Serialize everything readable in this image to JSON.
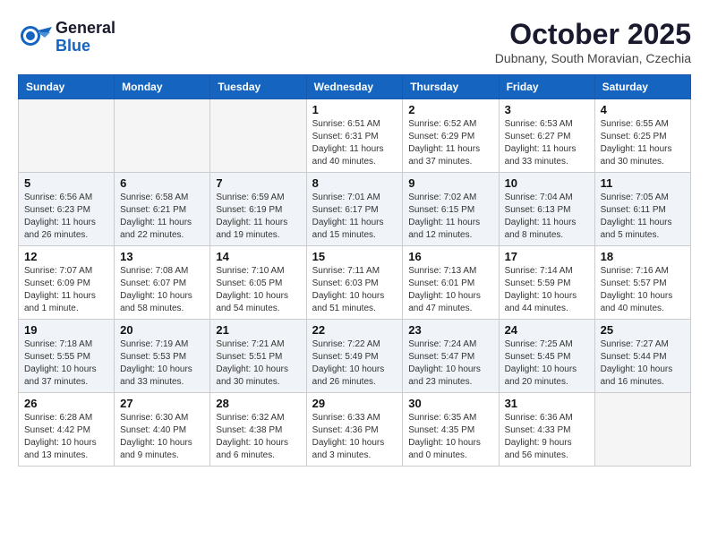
{
  "header": {
    "logo_line1": "General",
    "logo_line2": "Blue",
    "month_title": "October 2025",
    "subtitle": "Dubnany, South Moravian, Czechia"
  },
  "weekdays": [
    "Sunday",
    "Monday",
    "Tuesday",
    "Wednesday",
    "Thursday",
    "Friday",
    "Saturday"
  ],
  "weeks": [
    [
      {
        "day": "",
        "info": ""
      },
      {
        "day": "",
        "info": ""
      },
      {
        "day": "",
        "info": ""
      },
      {
        "day": "1",
        "info": "Sunrise: 6:51 AM\nSunset: 6:31 PM\nDaylight: 11 hours\nand 40 minutes."
      },
      {
        "day": "2",
        "info": "Sunrise: 6:52 AM\nSunset: 6:29 PM\nDaylight: 11 hours\nand 37 minutes."
      },
      {
        "day": "3",
        "info": "Sunrise: 6:53 AM\nSunset: 6:27 PM\nDaylight: 11 hours\nand 33 minutes."
      },
      {
        "day": "4",
        "info": "Sunrise: 6:55 AM\nSunset: 6:25 PM\nDaylight: 11 hours\nand 30 minutes."
      }
    ],
    [
      {
        "day": "5",
        "info": "Sunrise: 6:56 AM\nSunset: 6:23 PM\nDaylight: 11 hours\nand 26 minutes."
      },
      {
        "day": "6",
        "info": "Sunrise: 6:58 AM\nSunset: 6:21 PM\nDaylight: 11 hours\nand 22 minutes."
      },
      {
        "day": "7",
        "info": "Sunrise: 6:59 AM\nSunset: 6:19 PM\nDaylight: 11 hours\nand 19 minutes."
      },
      {
        "day": "8",
        "info": "Sunrise: 7:01 AM\nSunset: 6:17 PM\nDaylight: 11 hours\nand 15 minutes."
      },
      {
        "day": "9",
        "info": "Sunrise: 7:02 AM\nSunset: 6:15 PM\nDaylight: 11 hours\nand 12 minutes."
      },
      {
        "day": "10",
        "info": "Sunrise: 7:04 AM\nSunset: 6:13 PM\nDaylight: 11 hours\nand 8 minutes."
      },
      {
        "day": "11",
        "info": "Sunrise: 7:05 AM\nSunset: 6:11 PM\nDaylight: 11 hours\nand 5 minutes."
      }
    ],
    [
      {
        "day": "12",
        "info": "Sunrise: 7:07 AM\nSunset: 6:09 PM\nDaylight: 11 hours\nand 1 minute."
      },
      {
        "day": "13",
        "info": "Sunrise: 7:08 AM\nSunset: 6:07 PM\nDaylight: 10 hours\nand 58 minutes."
      },
      {
        "day": "14",
        "info": "Sunrise: 7:10 AM\nSunset: 6:05 PM\nDaylight: 10 hours\nand 54 minutes."
      },
      {
        "day": "15",
        "info": "Sunrise: 7:11 AM\nSunset: 6:03 PM\nDaylight: 10 hours\nand 51 minutes."
      },
      {
        "day": "16",
        "info": "Sunrise: 7:13 AM\nSunset: 6:01 PM\nDaylight: 10 hours\nand 47 minutes."
      },
      {
        "day": "17",
        "info": "Sunrise: 7:14 AM\nSunset: 5:59 PM\nDaylight: 10 hours\nand 44 minutes."
      },
      {
        "day": "18",
        "info": "Sunrise: 7:16 AM\nSunset: 5:57 PM\nDaylight: 10 hours\nand 40 minutes."
      }
    ],
    [
      {
        "day": "19",
        "info": "Sunrise: 7:18 AM\nSunset: 5:55 PM\nDaylight: 10 hours\nand 37 minutes."
      },
      {
        "day": "20",
        "info": "Sunrise: 7:19 AM\nSunset: 5:53 PM\nDaylight: 10 hours\nand 33 minutes."
      },
      {
        "day": "21",
        "info": "Sunrise: 7:21 AM\nSunset: 5:51 PM\nDaylight: 10 hours\nand 30 minutes."
      },
      {
        "day": "22",
        "info": "Sunrise: 7:22 AM\nSunset: 5:49 PM\nDaylight: 10 hours\nand 26 minutes."
      },
      {
        "day": "23",
        "info": "Sunrise: 7:24 AM\nSunset: 5:47 PM\nDaylight: 10 hours\nand 23 minutes."
      },
      {
        "day": "24",
        "info": "Sunrise: 7:25 AM\nSunset: 5:45 PM\nDaylight: 10 hours\nand 20 minutes."
      },
      {
        "day": "25",
        "info": "Sunrise: 7:27 AM\nSunset: 5:44 PM\nDaylight: 10 hours\nand 16 minutes."
      }
    ],
    [
      {
        "day": "26",
        "info": "Sunrise: 6:28 AM\nSunset: 4:42 PM\nDaylight: 10 hours\nand 13 minutes."
      },
      {
        "day": "27",
        "info": "Sunrise: 6:30 AM\nSunset: 4:40 PM\nDaylight: 10 hours\nand 9 minutes."
      },
      {
        "day": "28",
        "info": "Sunrise: 6:32 AM\nSunset: 4:38 PM\nDaylight: 10 hours\nand 6 minutes."
      },
      {
        "day": "29",
        "info": "Sunrise: 6:33 AM\nSunset: 4:36 PM\nDaylight: 10 hours\nand 3 minutes."
      },
      {
        "day": "30",
        "info": "Sunrise: 6:35 AM\nSunset: 4:35 PM\nDaylight: 10 hours\nand 0 minutes."
      },
      {
        "day": "31",
        "info": "Sunrise: 6:36 AM\nSunset: 4:33 PM\nDaylight: 9 hours\nand 56 minutes."
      },
      {
        "day": "",
        "info": ""
      }
    ]
  ]
}
